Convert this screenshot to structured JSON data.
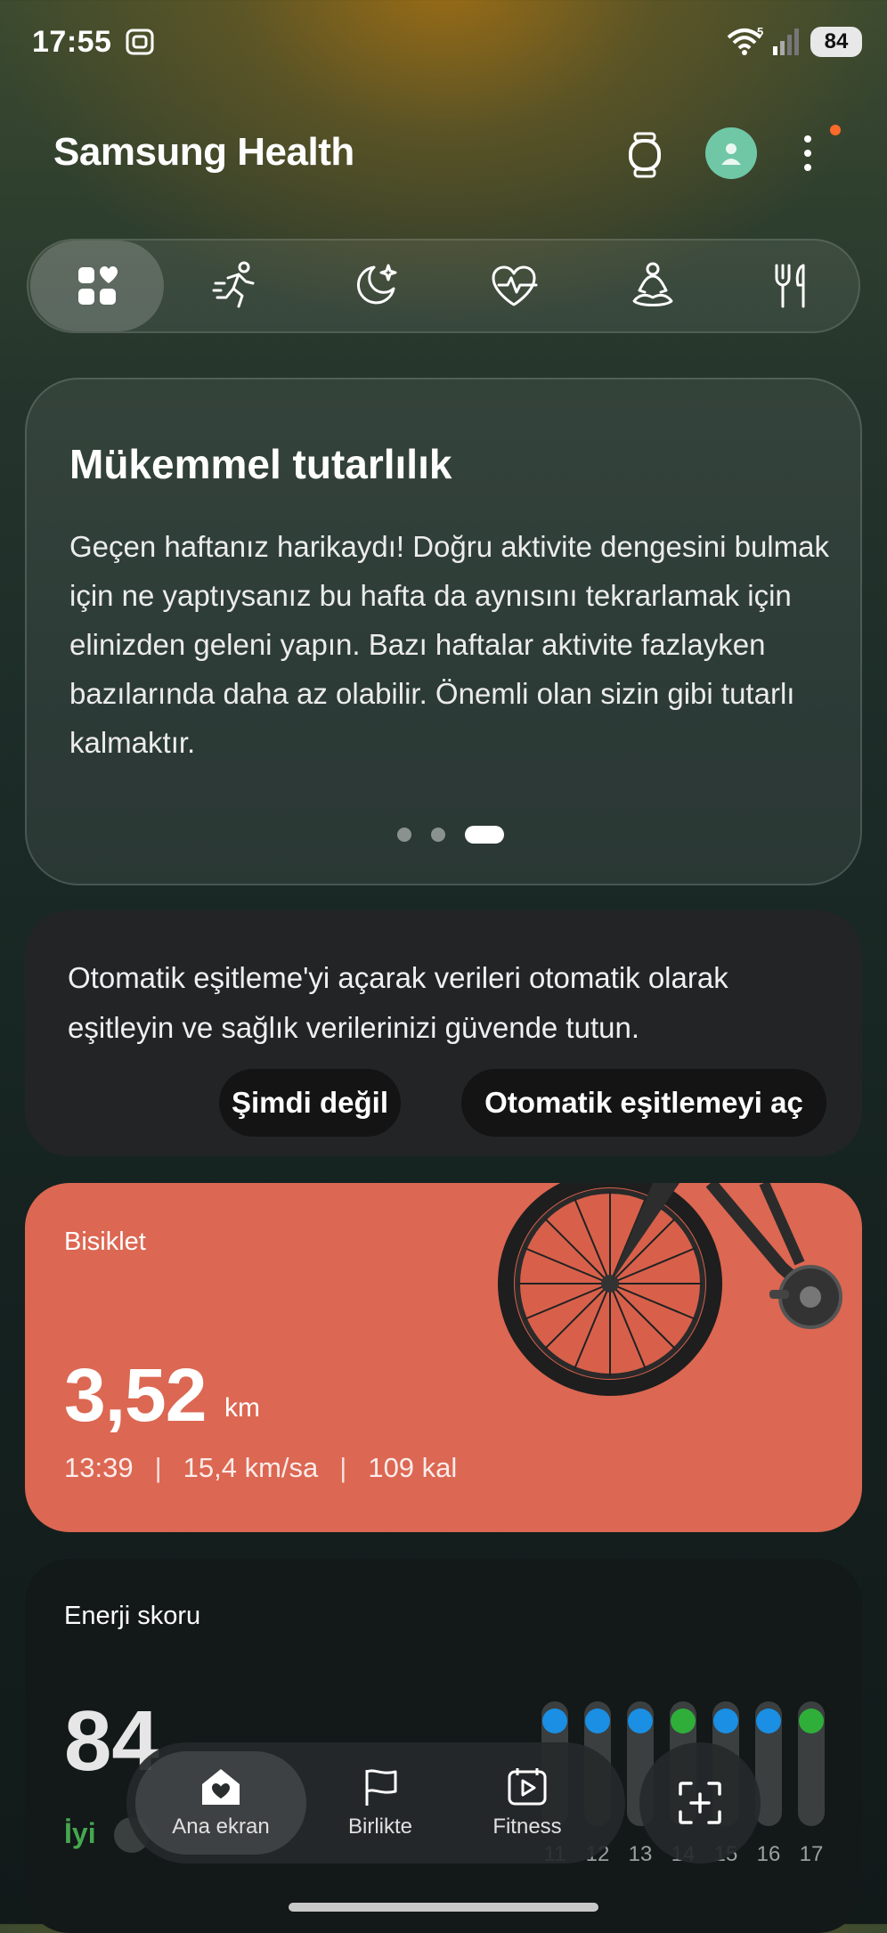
{
  "status_bar": {
    "time": "17:55",
    "battery": "84",
    "wifi_label": "5"
  },
  "header": {
    "title": "Samsung Health"
  },
  "tabs": [
    {
      "icon": "dashboard-icon"
    },
    {
      "icon": "running-icon"
    },
    {
      "icon": "sleep-icon"
    },
    {
      "icon": "heart-rate-icon"
    },
    {
      "icon": "mindfulness-icon"
    },
    {
      "icon": "food-icon"
    }
  ],
  "insight": {
    "title": "Mükemmel tutarlılık",
    "body": "Geçen haftanız harikaydı! Doğru aktivite dengesini bulmak için ne yaptıysanız bu hafta da aynısını tekrarlamak için elinizden geleni yapın. Bazı haftalar aktivite fazlayken bazılarında daha az olabilir. Önemli olan sizin gibi tutarlı kalmaktır.",
    "page": 3,
    "pages": 3
  },
  "sync": {
    "message": "Otomatik eşitleme'yi açarak verileri otomatik olarak eşitleyin ve sağlık verilerinizi güvende tutun.",
    "dismiss_label": "Şimdi değil",
    "enable_label": "Otomatik eşitlemeyi aç"
  },
  "bike": {
    "label": "Bisiklet",
    "distance": "3,52",
    "unit": "km",
    "duration": "13:39",
    "speed": "15,4 km/sa",
    "calories": "109 kal",
    "separator": "|",
    "color": "#dc6752"
  },
  "energy": {
    "label": "Enerji skoru",
    "score": "84",
    "rating": "İyi",
    "days": [
      "11",
      "12",
      "13",
      "14",
      "15",
      "16",
      "17"
    ],
    "day_status": [
      "blue",
      "blue",
      "blue",
      "green",
      "blue",
      "blue",
      "green"
    ],
    "colors": {
      "blue": "#1a8fe3",
      "green": "#2fae3a"
    }
  },
  "bottom_nav": {
    "home": "Ana ekran",
    "together": "Birlikte",
    "fitness": "Fitness"
  }
}
